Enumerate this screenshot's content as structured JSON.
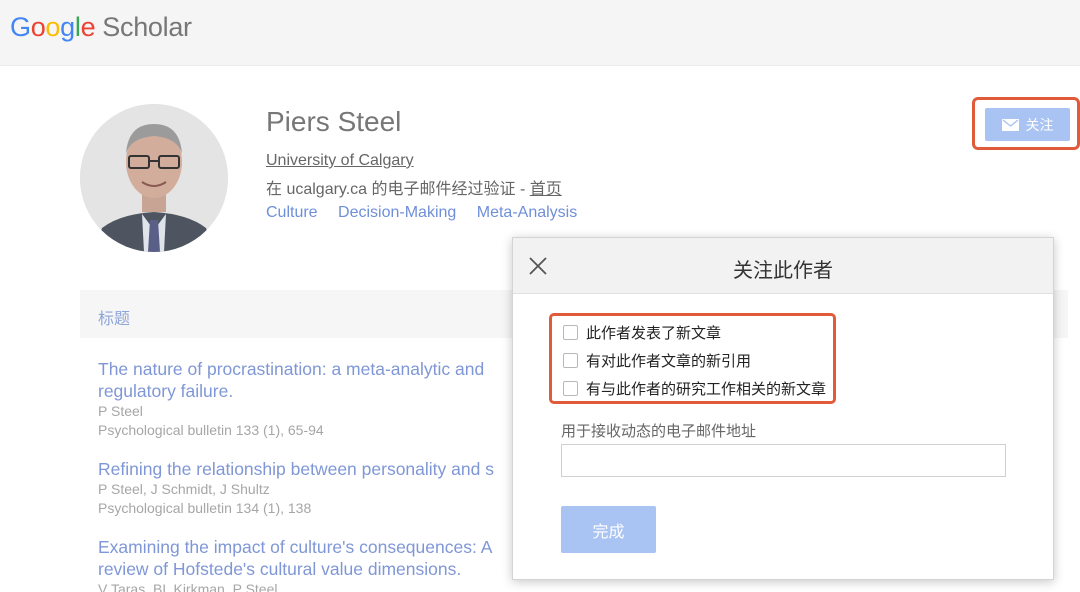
{
  "header": {
    "logo_letters": [
      "G",
      "o",
      "o",
      "g",
      "l",
      "e"
    ],
    "logo_word": "Scholar"
  },
  "profile": {
    "name": "Piers Steel",
    "affiliation": "University of Calgary",
    "verified_text": "在 ucalgary.ca 的电子邮件经过验证 - ",
    "homepage_link": "首页",
    "interests": [
      "Culture",
      "Decision-Making",
      "Meta-Analysis"
    ],
    "follow_label": "关注"
  },
  "table": {
    "title_header": "标题"
  },
  "articles": [
    {
      "title": "The nature of procrastination: a meta-analytic and",
      "title_line2": "regulatory failure.",
      "authors": "P Steel",
      "venue": "Psychological bulletin 133 (1), 65-94"
    },
    {
      "title": "Refining the relationship between personality and s",
      "authors": "P Steel, J Schmidt, J Shultz",
      "venue": "Psychological bulletin 134 (1), 138"
    },
    {
      "title": "Examining the impact of culture's consequences: A",
      "title_line2": "review of Hofstede's cultural value dimensions.",
      "authors": "V Taras, BL Kirkman, P Steel"
    }
  ],
  "dialog": {
    "title": "关注此作者",
    "options": [
      "此作者发表了新文章",
      "有对此作者文章的新引用",
      "有与此作者的研究工作相关的新文章"
    ],
    "email_label": "用于接收动态的电子邮件地址",
    "email_value": "",
    "done_label": "完成"
  },
  "colors": {
    "accent_button": "#a9c3f3",
    "highlight_box": "#e05b3a",
    "link_faded": "#7f97d6"
  }
}
